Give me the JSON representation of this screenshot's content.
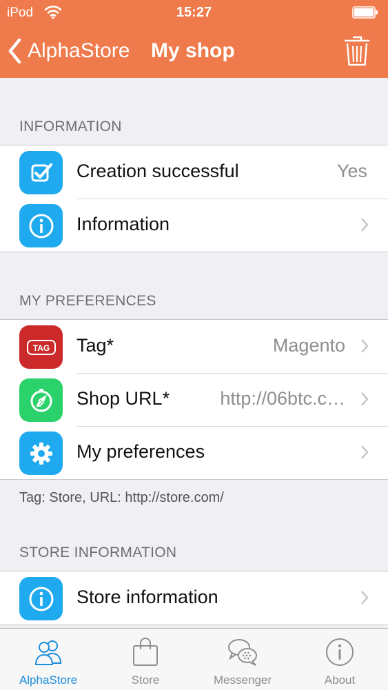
{
  "status_bar": {
    "carrier": "iPod",
    "time": "15:27"
  },
  "nav": {
    "back_label": "AlphaStore",
    "title": "My shop"
  },
  "colors": {
    "header": "#ef7b4c",
    "blue_icon": "#1fa9ee",
    "red_icon": "#cc2a2a",
    "green_icon": "#2bd26b",
    "active_tab": "#1b8ddb"
  },
  "sections": {
    "information": {
      "header": "INFORMATION",
      "rows": [
        {
          "icon": "checkbox-icon",
          "label": "Creation successful",
          "value": "Yes"
        },
        {
          "icon": "info-icon",
          "label": "Information"
        }
      ]
    },
    "preferences": {
      "header": "MY PREFERENCES",
      "rows": [
        {
          "icon": "tag-icon",
          "icon_text": "TAG",
          "label": "Tag*",
          "value": "Magento"
        },
        {
          "icon": "compass-icon",
          "label": "Shop URL*",
          "value": "http://06btc.c…"
        },
        {
          "icon": "gear-icon",
          "label": "My preferences"
        }
      ],
      "footer": "Tag: Store, URL: http://store.com/"
    },
    "store_information": {
      "header": "STORE INFORMATION",
      "rows": [
        {
          "icon": "info-icon",
          "label": "Store information"
        }
      ]
    }
  },
  "tabs": [
    {
      "label": "AlphaStore",
      "icon": "users-icon",
      "active": true
    },
    {
      "label": "Store",
      "icon": "shopping-bag-icon"
    },
    {
      "label": "Messenger",
      "icon": "chat-bubbles-icon"
    },
    {
      "label": "About",
      "icon": "info-icon"
    }
  ]
}
